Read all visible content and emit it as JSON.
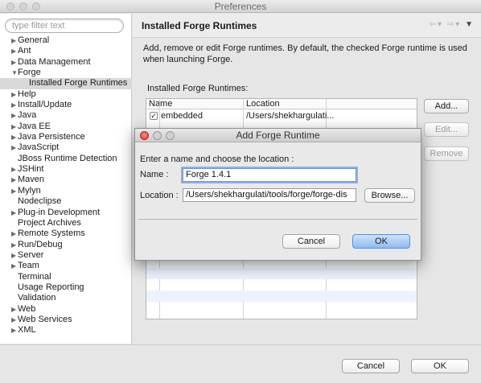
{
  "window": {
    "title": "Preferences"
  },
  "filter": {
    "placeholder": "type filter text"
  },
  "tree": [
    {
      "label": "General",
      "arrow": "▶"
    },
    {
      "label": "Ant",
      "arrow": "▶"
    },
    {
      "label": "Data Management",
      "arrow": "▶"
    },
    {
      "label": "Forge",
      "arrow": "▼"
    },
    {
      "label": "Installed Forge Runtimes",
      "arrow": "",
      "child": true,
      "selected": true
    },
    {
      "label": "Help",
      "arrow": "▶"
    },
    {
      "label": "Install/Update",
      "arrow": "▶"
    },
    {
      "label": "Java",
      "arrow": "▶"
    },
    {
      "label": "Java EE",
      "arrow": "▶"
    },
    {
      "label": "Java Persistence",
      "arrow": "▶"
    },
    {
      "label": "JavaScript",
      "arrow": "▶"
    },
    {
      "label": "JBoss Runtime Detection",
      "arrow": ""
    },
    {
      "label": "JSHint",
      "arrow": "▶"
    },
    {
      "label": "Maven",
      "arrow": "▶"
    },
    {
      "label": "Mylyn",
      "arrow": "▶"
    },
    {
      "label": "Nodeclipse",
      "arrow": ""
    },
    {
      "label": "Plug-in Development",
      "arrow": "▶"
    },
    {
      "label": "Project Archives",
      "arrow": ""
    },
    {
      "label": "Remote Systems",
      "arrow": "▶"
    },
    {
      "label": "Run/Debug",
      "arrow": "▶"
    },
    {
      "label": "Server",
      "arrow": "▶"
    },
    {
      "label": "Team",
      "arrow": "▶"
    },
    {
      "label": "Terminal",
      "arrow": ""
    },
    {
      "label": "Usage Reporting",
      "arrow": ""
    },
    {
      "label": "Validation",
      "arrow": ""
    },
    {
      "label": "Web",
      "arrow": "▶"
    },
    {
      "label": "Web Services",
      "arrow": "▶"
    },
    {
      "label": "XML",
      "arrow": "▶"
    }
  ],
  "page": {
    "title": "Installed Forge Runtimes",
    "description": "Add, remove or edit Forge runtimes. By default, the checked Forge runtime is used when launching Forge.",
    "list_label": "Installed Forge Runtimes:",
    "columns": {
      "name": "Name",
      "location": "Location"
    },
    "rows": [
      {
        "checked": "✓",
        "name": "embedded",
        "location": "/Users/shekhargulati..."
      }
    ],
    "buttons": {
      "add": "Add...",
      "edit": "Edit...",
      "remove": "Remove"
    }
  },
  "footer": {
    "cancel": "Cancel",
    "ok": "OK"
  },
  "dialog": {
    "title": "Add Forge Runtime",
    "prompt": "Enter a name and choose the location :",
    "name_label": "Name :",
    "name_value": "Forge 1.4.1",
    "location_label": "Location :",
    "location_value": "/Users/shekhargulati/tools/forge/forge-dis",
    "browse": "Browse...",
    "cancel": "Cancel",
    "ok": "OK"
  },
  "colors": {
    "accent": "#8fbaf0",
    "selection": "#d9d9d9",
    "close": "#d9322a"
  }
}
